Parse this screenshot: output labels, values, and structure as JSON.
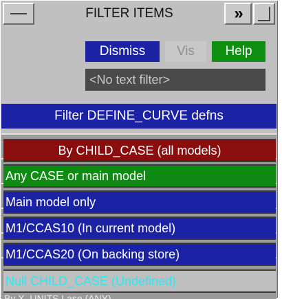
{
  "window": {
    "title": "FILTER ITEMS",
    "arrows_label": "»"
  },
  "buttons": {
    "dismiss": "Dismiss",
    "vis": "Vis",
    "help": "Help"
  },
  "text_filter": {
    "value": "<No text filter>"
  },
  "filter_header": "Filter DEFINE_CURVE defns",
  "menu": {
    "items": [
      {
        "label": "By CHILD_CASE (all models)",
        "bg": "#8b0e0e",
        "color": "#ffffff"
      },
      {
        "label": "Any CASE or main model",
        "bg": "#0f8a13",
        "color": "#ffffff"
      },
      {
        "label": "Main model only",
        "bg": "#1b22a3",
        "color": "#ffffff"
      },
      {
        "label": "M1/CCAS10 (In current model)",
        "bg": "#1b22a3",
        "color": "#ffffff"
      },
      {
        "label": "M1/CCAS20 (On backing store)",
        "bg": "#1b22a3",
        "color": "#ffffff"
      },
      {
        "label": "Null CHILD_CASE (Undefined)",
        "bg": "#c0c0c0",
        "color": "#2fe7f0"
      }
    ]
  },
  "under_list": {
    "last_item": "By X_UNITS Lase (ANY)"
  },
  "colors": {
    "panel_bg": "#c0c0c0",
    "blue": "#1b22a3",
    "green": "#0e8f12",
    "red": "#8b0e0e"
  }
}
